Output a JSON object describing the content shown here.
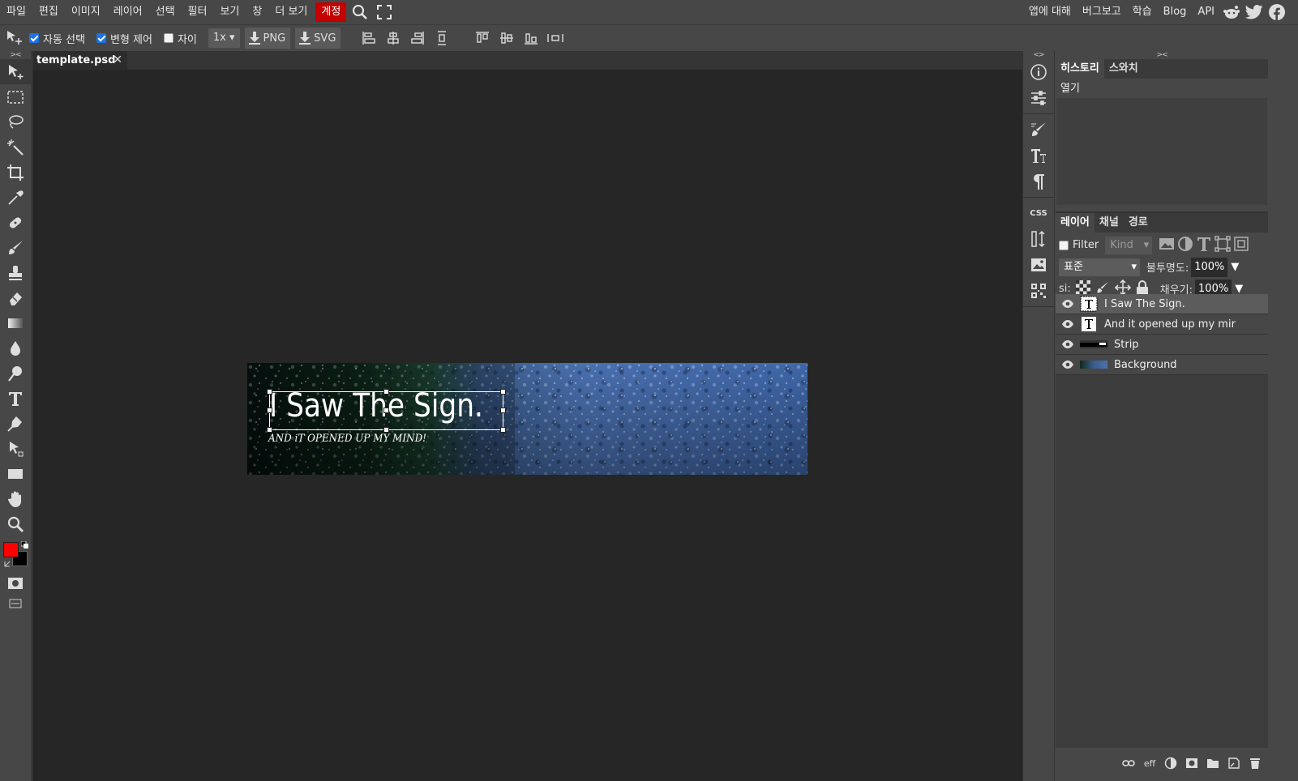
{
  "menu": {
    "items": [
      "파일",
      "편집",
      "이미지",
      "레이어",
      "선택",
      "필터",
      "보기",
      "창",
      "더 보기"
    ],
    "account": "계정",
    "right": [
      "앱에 대해",
      "버그보고",
      "학습",
      "Blog",
      "API"
    ]
  },
  "options": {
    "auto_select": "자동 선택",
    "transform": "변형 제어",
    "distance": "자이",
    "zoom": "1x",
    "png": "PNG",
    "svg": "SVG"
  },
  "document": {
    "tab": "template.psd",
    "close": "✕",
    "title": "I Saw The Sign.",
    "subtitle": "AND iT OPENED UP MY MIND!"
  },
  "colors": {
    "foreground": "#ff0000",
    "background": "#000000",
    "account": "#c40000"
  },
  "history": {
    "tabs": [
      "히스토리",
      "스와치"
    ],
    "items": [
      "열기"
    ]
  },
  "layers_panel": {
    "tabs": [
      "레이어",
      "채널",
      "경로"
    ],
    "filter": "Filter",
    "kind": "Kind",
    "blend": "표준",
    "opacity_label": "불투명도:",
    "opacity": "100%",
    "lock_label": "si:",
    "fill_label": "채우기:",
    "fill": "100%",
    "layers": [
      {
        "name": "I Saw The Sign.",
        "type": "text"
      },
      {
        "name": "And it opened up my mir",
        "type": "text"
      },
      {
        "name": "Strip",
        "type": "image"
      },
      {
        "name": "Background",
        "type": "image"
      }
    ],
    "footer_eff": "eff"
  },
  "strip_icons": [
    "info-icon",
    "adjust-icon",
    "brush-settings-icon",
    "character-icon",
    "paragraph-icon",
    "css-icon",
    "sort-icon",
    "image-icon",
    "qr-icon"
  ],
  "css_label": "CSS"
}
